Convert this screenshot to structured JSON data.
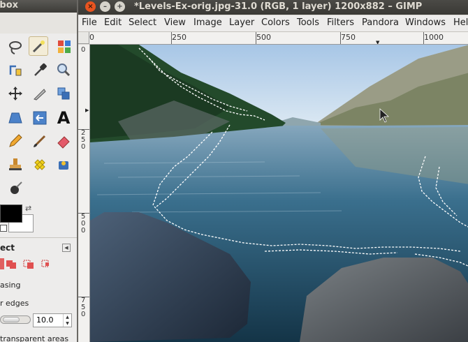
{
  "toolbox": {
    "title": "olbox",
    "tools": [
      {
        "icon": "lasso-icon"
      },
      {
        "icon": "fuzzy-select-wand-icon",
        "active": true
      },
      {
        "icon": "select-by-color-icon"
      },
      {
        "icon": "paths-tool-icon"
      },
      {
        "icon": "color-picker-icon"
      },
      {
        "icon": "zoom-icon"
      },
      {
        "icon": "move-icon"
      },
      {
        "icon": "crop-knife-icon"
      },
      {
        "icon": "rotate-transform-icon"
      },
      {
        "icon": "shear-transform-icon"
      },
      {
        "icon": "flip-icon"
      },
      {
        "icon": "text-tool-icon",
        "glyph": "A"
      },
      {
        "icon": "pencil-icon"
      },
      {
        "icon": "paintbrush-icon"
      },
      {
        "icon": "eraser-icon"
      },
      {
        "icon": "clone-stamp-icon"
      },
      {
        "icon": "heal-icon"
      },
      {
        "icon": "bucket-fill-icon"
      },
      {
        "icon": "ink-blur-icon"
      }
    ],
    "options": {
      "title": "ect",
      "antialias_label": "asing",
      "feather_label": "r edges",
      "feather_value": "10.0",
      "select_transparent_label": "transparent areas"
    }
  },
  "window": {
    "title": "*Levels-Ex-orig.jpg-31.0 (RGB, 1 layer) 1200x882 – GIMP",
    "buttons": {
      "close": "×",
      "minimize": "–",
      "maximize": "+"
    }
  },
  "menubar": [
    "File",
    "Edit",
    "Select",
    "View",
    "Image",
    "Layer",
    "Colors",
    "Tools",
    "Filters",
    "Pandora",
    "Windows",
    "Hel"
  ],
  "ruler": {
    "h_labels": [
      "0",
      "250",
      "500",
      "750",
      "1000"
    ],
    "v_labels": [
      "0",
      "2\n5\n0",
      "5\n0\n0",
      "7\n5\n0"
    ]
  },
  "colors": {
    "title_bar": "#3c3b37",
    "close_button": "#e95420",
    "window_button": "#d6d3cb",
    "selection_marching_ants": "#ffffff"
  }
}
